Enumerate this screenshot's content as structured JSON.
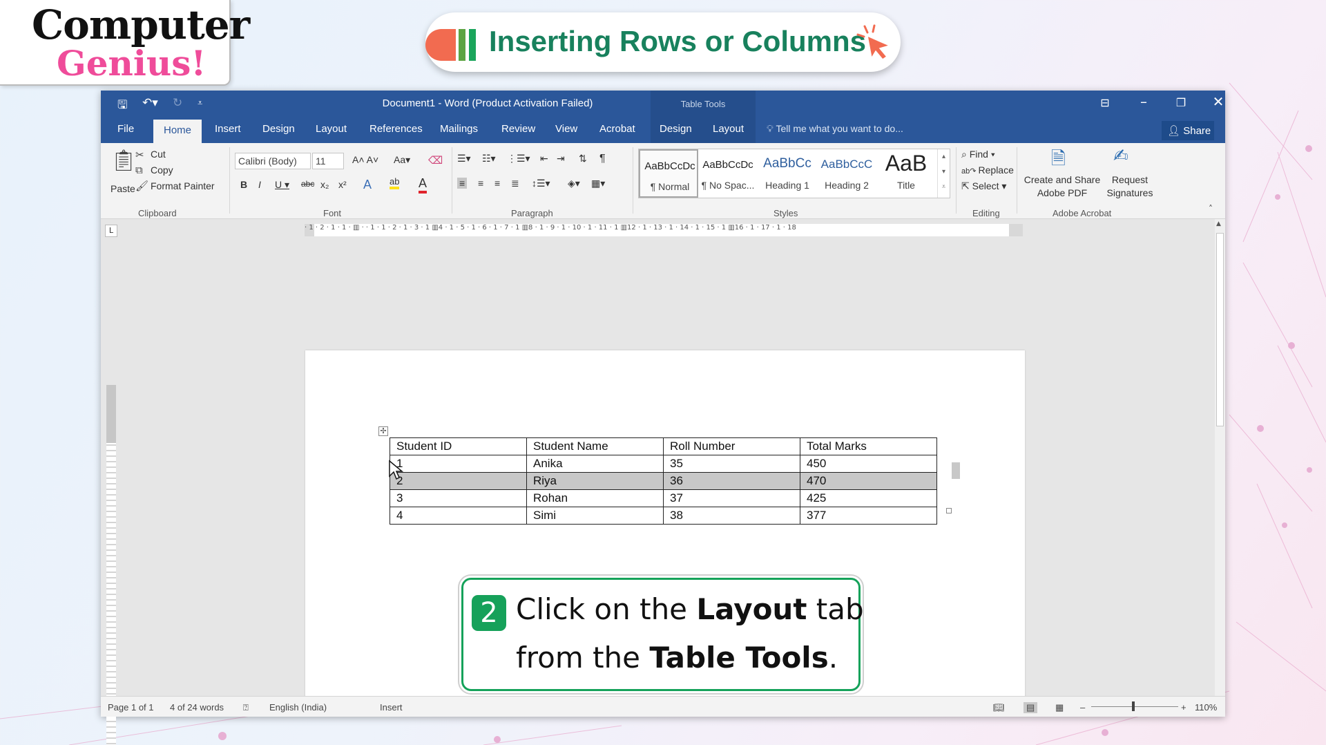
{
  "logo": {
    "line1": "Computer",
    "line2": "Genius!"
  },
  "lesson": {
    "title": "Inserting Rows or Columns"
  },
  "window": {
    "title": "Document1 - Word (Product Activation Failed)",
    "contextual_group": "Table Tools",
    "tell_me": "Tell me what you want to do...",
    "share": "Share"
  },
  "tabs": [
    "File",
    "Home",
    "Insert",
    "Design",
    "Layout",
    "References",
    "Mailings",
    "Review",
    "View",
    "Acrobat"
  ],
  "table_tools_tabs": [
    "Design",
    "Layout"
  ],
  "ribbon": {
    "clipboard": {
      "paste": "Paste",
      "cut": "Cut",
      "copy": "Copy",
      "format_painter": "Format Painter",
      "label": "Clipboard"
    },
    "font": {
      "name": "Calibri (Body)",
      "size": "11",
      "label": "Font"
    },
    "paragraph": {
      "label": "Paragraph"
    },
    "styles": {
      "label": "Styles",
      "items": [
        {
          "preview": "AaBbCcDc",
          "name": "¶ Normal"
        },
        {
          "preview": "AaBbCcDc",
          "name": "¶ No Spac..."
        },
        {
          "preview": "AaBbCc",
          "name": "Heading 1"
        },
        {
          "preview": "AaBbCcC",
          "name": "Heading 2"
        },
        {
          "preview": "AaB",
          "name": "Title"
        }
      ]
    },
    "editing": {
      "find": "Find",
      "replace": "Replace",
      "select": "Select",
      "label": "Editing"
    },
    "acrobat": {
      "create_line1": "Create and Share",
      "create_line2": "Adobe PDF",
      "request_line1": "Request",
      "request_line2": "Signatures",
      "label": "Adobe Acrobat"
    }
  },
  "ruler": "· 1 · 2 · 1 · 1 · ▥ · · 1 · 1 · 2 · 1 · 3 · 1 ▥4 · 1 · 5 · 1 · 6 · 1 · 7 · 1 ▥8 · 1 · 9 · 1 · 10 · 1 · 11 · 1 ▥12 · 1 · 13 · 1 · 14 · 1 · 15 · 1 ▥16 · 1 · 17 · 1 · 18",
  "table": {
    "headers": [
      "Student ID",
      "Student Name",
      "Roll Number",
      "Total Marks"
    ],
    "rows": [
      [
        "1",
        "Anika",
        "35",
        "450"
      ],
      [
        "2",
        "Riya",
        "36",
        "470"
      ],
      [
        "3",
        "Rohan",
        "37",
        "425"
      ],
      [
        "4",
        "Simi",
        "38",
        "377"
      ]
    ],
    "highlighted_row": 2
  },
  "status": {
    "page": "Page 1 of 1",
    "words": "4 of 24 words",
    "language": "English (India)",
    "mode": "Insert",
    "zoom": "110%"
  },
  "callout": {
    "step": "2",
    "line1_pre": "Click on the ",
    "line1_bold": "Layout",
    "line1_post": " tab",
    "line2_pre": "from the ",
    "line2_bold": "Table Tools",
    "line2_post": "."
  },
  "colors": {
    "word_blue": "#2b579a",
    "accent_green": "#16a15a",
    "title_green": "#18815d",
    "logo_pink": "#ef4c9a"
  }
}
